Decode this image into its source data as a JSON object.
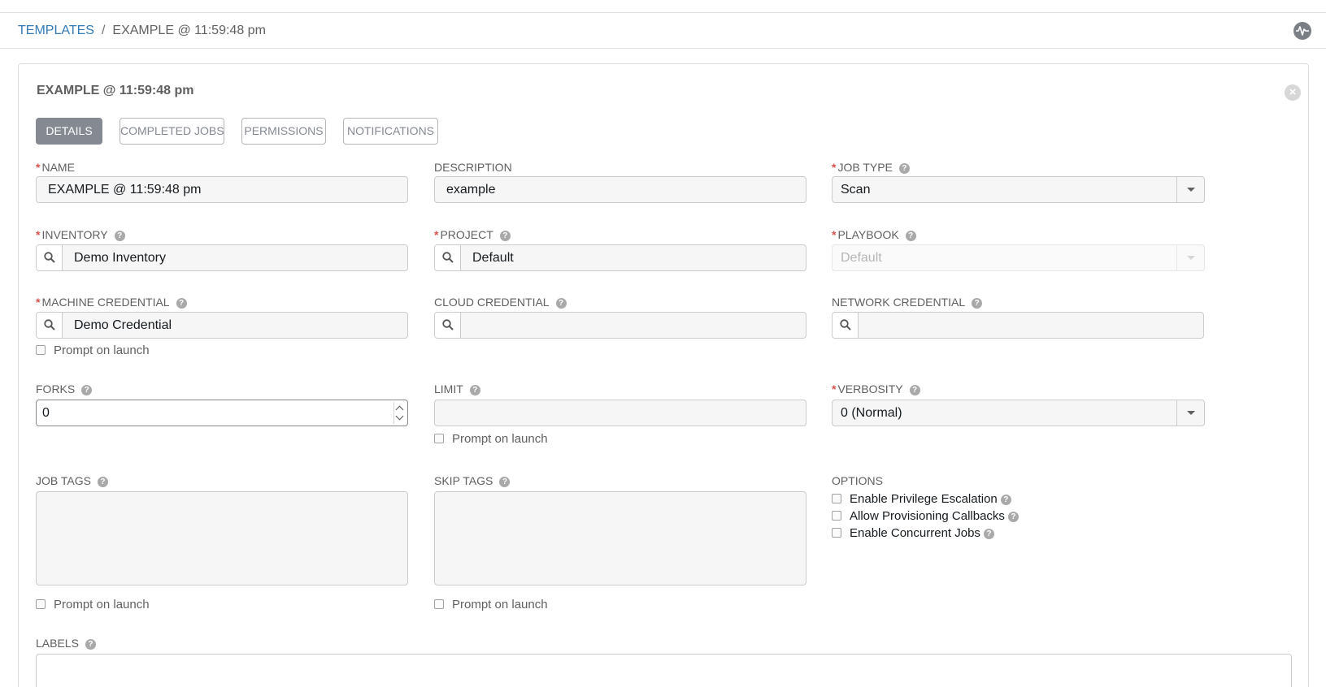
{
  "breadcrumb": {
    "parent": "TEMPLATES",
    "separator": "/",
    "current": "EXAMPLE @ 11:59:48 pm"
  },
  "panel": {
    "title": "EXAMPLE @ 11:59:48 pm"
  },
  "tabs": [
    {
      "label": "DETAILS",
      "active": true
    },
    {
      "label": "COMPLETED JOBS",
      "active": false
    },
    {
      "label": "PERMISSIONS",
      "active": false
    },
    {
      "label": "NOTIFICATIONS",
      "active": false
    }
  ],
  "fields": {
    "name": {
      "label": "NAME",
      "required": true,
      "value": "EXAMPLE @ 11:59:48 pm"
    },
    "description": {
      "label": "DESCRIPTION",
      "value": "example"
    },
    "job_type": {
      "label": "JOB TYPE",
      "required": true,
      "value": "Scan"
    },
    "inventory": {
      "label": "INVENTORY",
      "required": true,
      "value": "Demo Inventory"
    },
    "project": {
      "label": "PROJECT",
      "required": true,
      "value": "Default"
    },
    "playbook": {
      "label": "PLAYBOOK",
      "required": true,
      "value": "Default"
    },
    "machine_credential": {
      "label": "MACHINE CREDENTIAL",
      "required": true,
      "value": "Demo Credential"
    },
    "cloud_credential": {
      "label": "CLOUD CREDENTIAL",
      "value": ""
    },
    "network_credential": {
      "label": "NETWORK CREDENTIAL",
      "value": ""
    },
    "forks": {
      "label": "FORKS",
      "value": "0"
    },
    "limit": {
      "label": "LIMIT",
      "value": ""
    },
    "verbosity": {
      "label": "VERBOSITY",
      "required": true,
      "value": "0 (Normal)"
    },
    "job_tags": {
      "label": "JOB TAGS"
    },
    "skip_tags": {
      "label": "SKIP TAGS"
    },
    "options": {
      "label": "OPTIONS"
    },
    "labels": {
      "label": "LABELS"
    }
  },
  "prompt_on_launch": "Prompt on launch",
  "options": [
    {
      "label": "Enable Privilege Escalation"
    },
    {
      "label": "Allow Provisioning Callbacks"
    },
    {
      "label": "Enable Concurrent Jobs"
    }
  ],
  "required_mark": "*",
  "help_glyph": "?",
  "close_glyph": "×",
  "icons": {
    "activity": "activity-stream-icon",
    "search": "search-icon",
    "close": "close-icon",
    "help": "question-circle-icon"
  },
  "colors": {
    "link": "#337ab7",
    "required": "#d9534f",
    "tab_active": "#848992"
  }
}
